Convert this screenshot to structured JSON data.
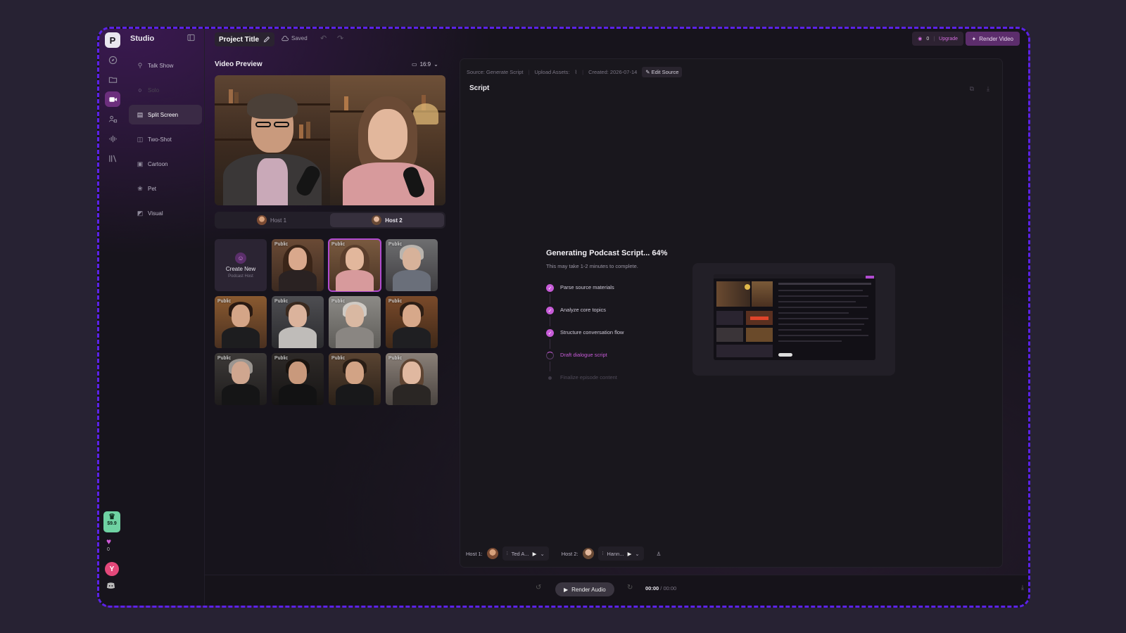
{
  "app": {
    "name": "Studio",
    "logo": "P"
  },
  "rail": {
    "icons": [
      "compass-icon",
      "folder-icon",
      "video-camera-icon",
      "people-icon",
      "waveform-icon",
      "library-icon"
    ],
    "credit_price": "$9.9",
    "heart_count": "0",
    "avatar_initial": "Y"
  },
  "sidebar": {
    "items": [
      {
        "label": "Talk Show",
        "icon": "mic-icon"
      },
      {
        "label": "Solo",
        "icon": "user-icon"
      },
      {
        "label": "Split Screen",
        "icon": "split-screen-icon"
      },
      {
        "label": "Two-Shot",
        "icon": "two-shot-icon"
      },
      {
        "label": "Cartoon",
        "icon": "cartoon-icon"
      },
      {
        "label": "Pet",
        "icon": "paw-icon"
      },
      {
        "label": "Visual",
        "icon": "image-icon"
      }
    ]
  },
  "header": {
    "project_title": "Project Title",
    "saved_label": "Saved",
    "credits_count": "0",
    "upgrade_label": "Upgrade",
    "render_video_label": "Render Video"
  },
  "preview": {
    "title": "Video Preview",
    "aspect_ratio": "16:9",
    "host_tabs": [
      {
        "label": "Host 1"
      },
      {
        "label": "Host 2"
      }
    ],
    "active_tab": "Host 2"
  },
  "host_grid": {
    "create_label": "Create New",
    "create_sub": "Podcast Host",
    "badge": "Public"
  },
  "script_panel": {
    "source": "Source: Generate Script",
    "upload_assets": "Upload Assets:",
    "created": "Created: 2026-07-14",
    "edit_source": "Edit Source",
    "title": "Script",
    "generating_title": "Generating Podcast Script... 64%",
    "generating_sub": "This may take 1-2 minutes to complete.",
    "progress": 0.64,
    "steps": [
      {
        "label": "Parse source materials",
        "state": "done"
      },
      {
        "label": "Analyze core topics",
        "state": "done"
      },
      {
        "label": "Structure conversation flow",
        "state": "done"
      },
      {
        "label": "Draft dialogue script",
        "state": "active"
      },
      {
        "label": "Finalize episode content",
        "state": "pending"
      }
    ],
    "host1_label": "Host 1:",
    "host1_voice": "Ted A...",
    "host2_label": "Host 2:",
    "host2_voice": "Hann..."
  },
  "transport": {
    "render_audio_label": "Render Audio",
    "time_current": "00:00",
    "time_total": "/ 00:00"
  },
  "colors": {
    "accent": "#c75bd8",
    "frame_border": "#5b22e8",
    "credit_green": "#6fd2a2",
    "avatar_pink": "#e4487a"
  }
}
